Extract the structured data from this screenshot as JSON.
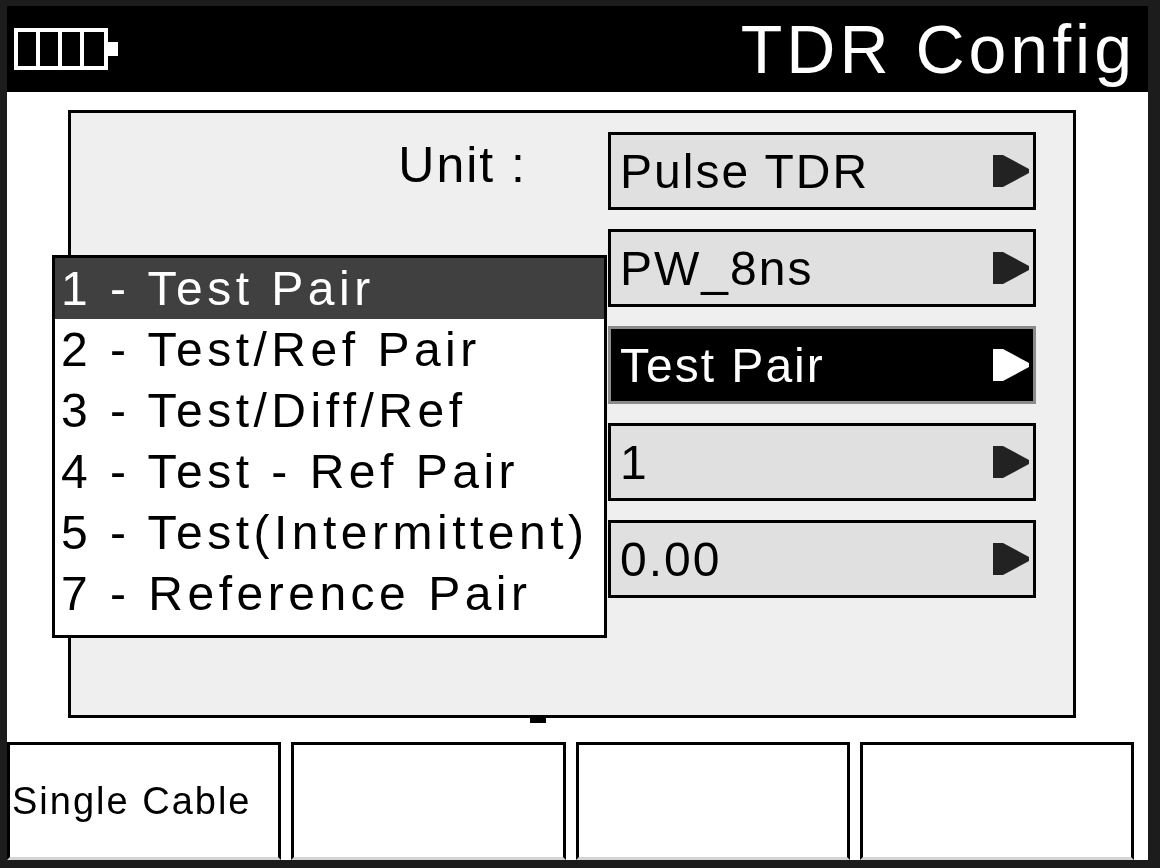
{
  "header": {
    "title": "TDR Config"
  },
  "settings": [
    {
      "label": "Unit :",
      "value": "Pulse TDR",
      "selected": false
    },
    {
      "value": "PW_8ns",
      "selected": false
    },
    {
      "value": "Test Pair",
      "selected": true
    },
    {
      "value": "1",
      "selected": false
    },
    {
      "value": "0.00",
      "selected": false
    }
  ],
  "dropdown": {
    "items": [
      {
        "label": "1 - Test Pair",
        "selected": true
      },
      {
        "label": "2 - Test/Ref Pair",
        "selected": false
      },
      {
        "label": "3 - Test/Diff/Ref",
        "selected": false
      },
      {
        "label": "4 - Test - Ref Pair",
        "selected": false
      },
      {
        "label": "5 - Test(Intermittent)",
        "selected": false
      },
      {
        "label": "7 - Reference Pair",
        "selected": false
      }
    ]
  },
  "softkeys": [
    {
      "kind": "labeled",
      "label": "Single Cable"
    },
    {
      "kind": "blank"
    },
    {
      "kind": "blank"
    },
    {
      "kind": "blank"
    }
  ]
}
